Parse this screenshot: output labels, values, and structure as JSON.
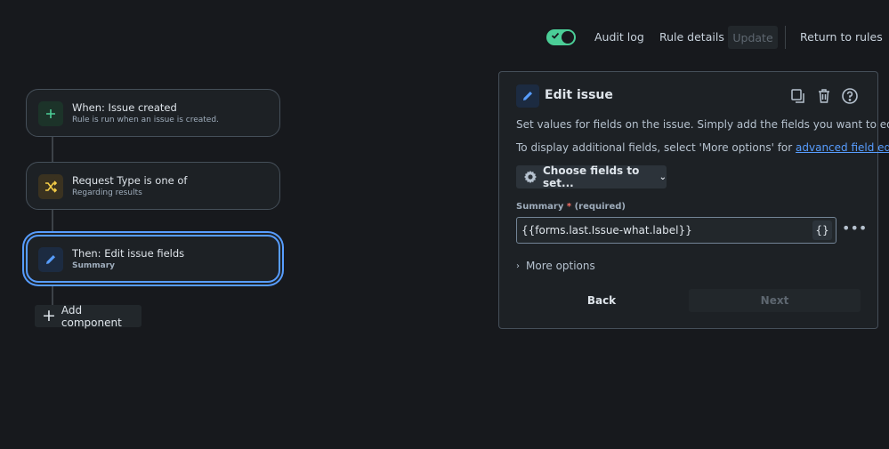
{
  "header": {
    "toggle_enabled": true,
    "audit_log": "Audit log",
    "rule_details": "Rule details",
    "update": "Update",
    "return_to_rules": "Return to rules"
  },
  "flow": {
    "nodes": [
      {
        "title": "When: Issue created",
        "subtitle": "Rule is run when an issue is created.",
        "icon": "plus-icon",
        "color": "#1c3329",
        "icon_color": "#4bce97"
      },
      {
        "title": "Request Type is one of",
        "subtitle": "Regarding results",
        "icon": "shuffle-icon",
        "color": "#3a3220",
        "icon_color": "#f5cd47"
      },
      {
        "title": "Then: Edit issue fields",
        "subtitle": "Summary",
        "icon": "pencil-icon",
        "color": "#1c2b41",
        "icon_color": "#579dff"
      }
    ],
    "add_component": "Add component"
  },
  "panel": {
    "title": "Edit issue",
    "description": "Set values for fields on the issue. Simply add the fields you want to edit.",
    "hint_prefix": "To display additional fields, select 'More options' for ",
    "hint_link": "advanced field editing",
    "hint_suffix": ".",
    "choose_fields": "Choose fields to set...",
    "field": {
      "label": "Summary",
      "required_mark": "*",
      "required_text": "(required)",
      "value": "{{forms.last.Issue-what.label}}",
      "braces": "{}"
    },
    "more_options": "More options",
    "back": "Back",
    "next": "Next"
  },
  "colors": {
    "background": "#17191d",
    "accent": "#579dff",
    "toggle": "#4bce97"
  }
}
